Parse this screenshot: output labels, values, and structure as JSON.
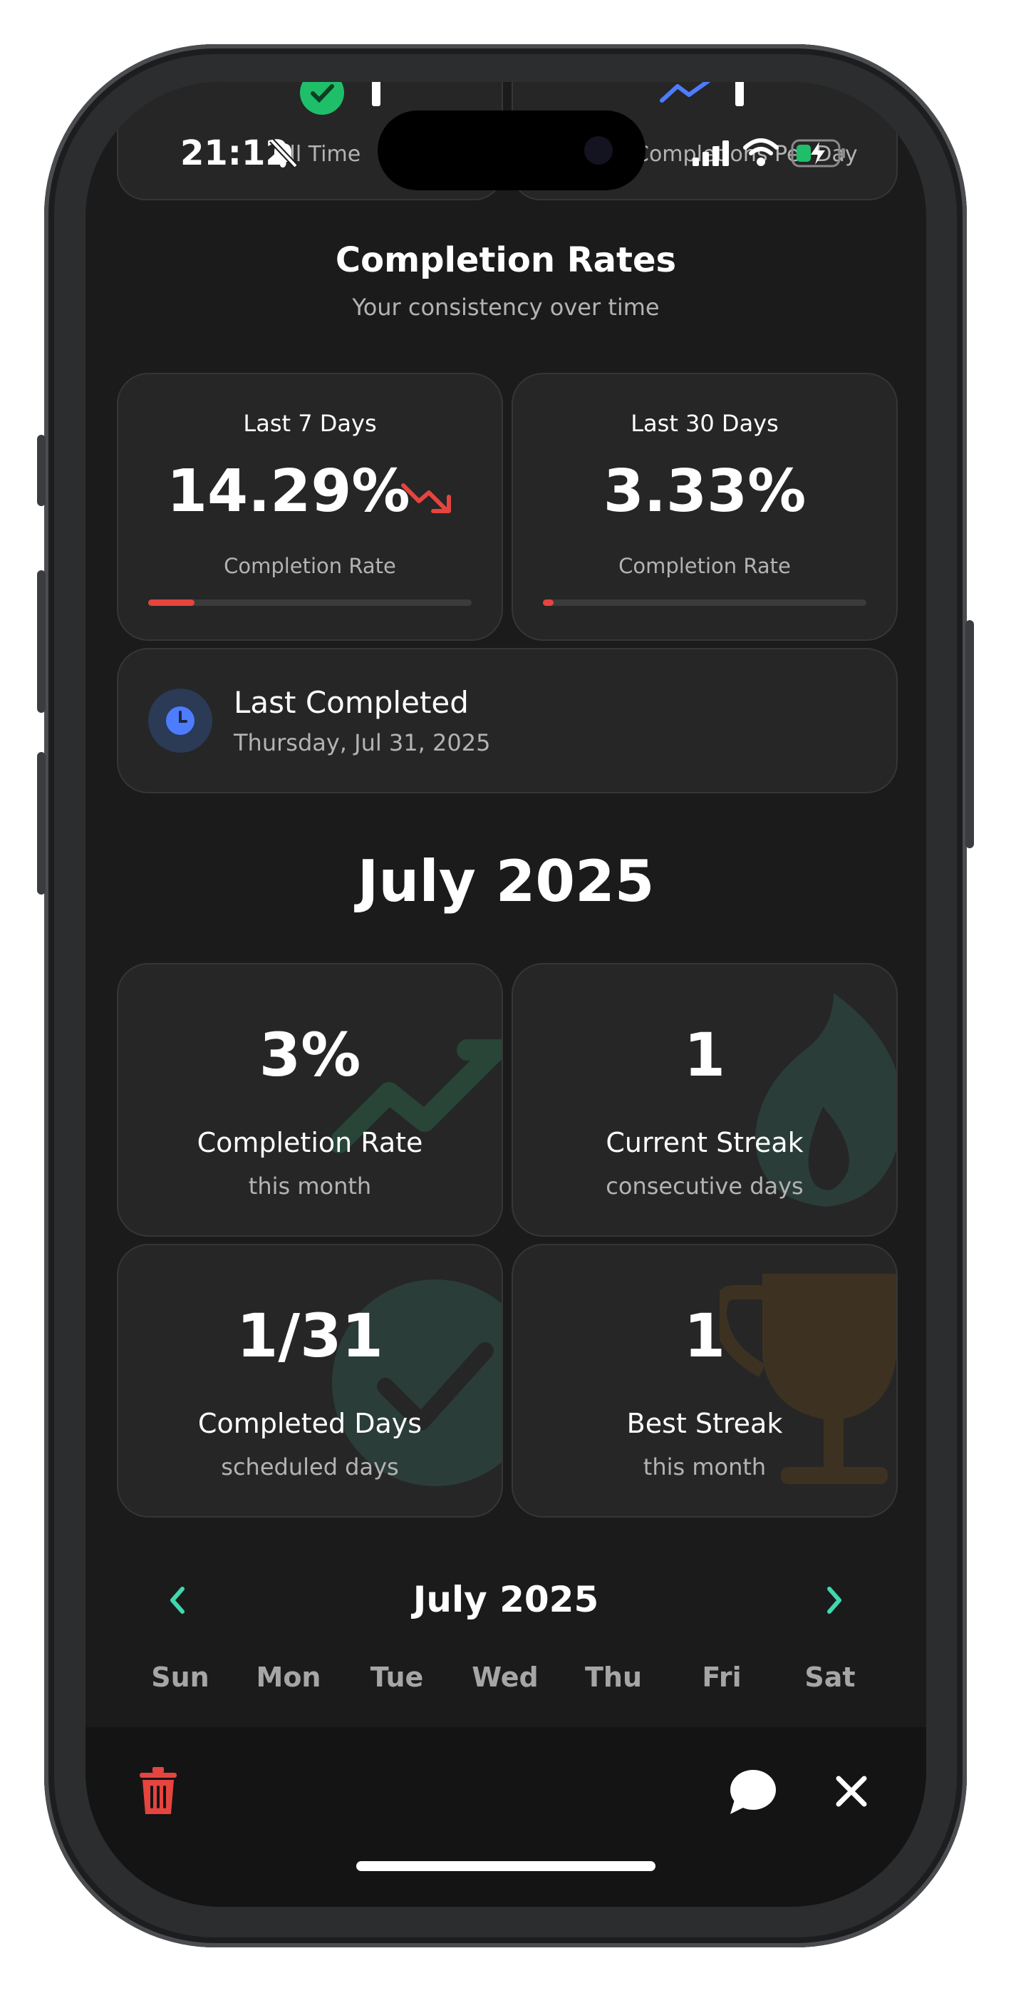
{
  "status_bar": {
    "time": "21:12"
  },
  "top_cards": {
    "left_label": "All Time",
    "right_label": "Completions Per Day"
  },
  "completion_section": {
    "title": "Completion Rates",
    "subtitle": "Your consistency over time"
  },
  "rate_cards": [
    {
      "label": "Last 7 Days",
      "value": "14.29%",
      "caption": "Completion Rate",
      "progress": 0.1429,
      "trend": "down"
    },
    {
      "label": "Last 30 Days",
      "value": "3.33%",
      "caption": "Completion Rate",
      "progress": 0.0333
    }
  ],
  "last_completed": {
    "title": "Last Completed",
    "date": "Thursday, Jul 31, 2025"
  },
  "month_heading": "July 2025",
  "stats": [
    {
      "value": "3%",
      "title": "Completion Rate",
      "sub": "this month",
      "icon": "trend-up-icon"
    },
    {
      "value": "1",
      "title": "Current Streak",
      "sub": "consecutive days",
      "icon": "flame-icon"
    },
    {
      "value": "1/31",
      "title": "Completed Days",
      "sub": "scheduled days",
      "icon": "check-circle-icon"
    },
    {
      "value": "1",
      "title": "Best Streak",
      "sub": "this month",
      "icon": "trophy-icon"
    }
  ],
  "calendar": {
    "month_label": "July 2025",
    "weekdays": [
      "Sun",
      "Mon",
      "Tue",
      "Wed",
      "Thu",
      "Fri",
      "Sat"
    ]
  },
  "colors": {
    "background": "#1b1b1b",
    "card": "#262626",
    "accent_teal": "#3fd8b0",
    "danger_red": "#e5443f",
    "clock_blue": "#4d7cff",
    "green": "#1fbf6a"
  }
}
